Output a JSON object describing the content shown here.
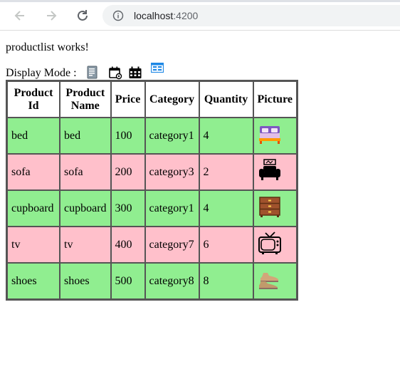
{
  "browser": {
    "url_host": "localhost",
    "url_port": ":4200"
  },
  "page": {
    "status_text": "productlist works!",
    "display_mode_label": "Display Mode :",
    "display_modes": [
      {
        "icon": "document-icon"
      },
      {
        "icon": "calendar-view-icon"
      },
      {
        "icon": "calendar-icon"
      },
      {
        "icon": "grid-table-icon"
      }
    ]
  },
  "table": {
    "headers": {
      "id_line1": "Product",
      "id_line2": "Id",
      "name_line1": "Product",
      "name_line2": "Name",
      "price": "Price",
      "category": "Category",
      "quantity": "Quantity",
      "picture": "Picture"
    },
    "rows": [
      {
        "id": "bed",
        "name": "bed",
        "price": "100",
        "category": "category1",
        "quantity": "4",
        "picture": "bed-icon",
        "bg": "#90ee90"
      },
      {
        "id": "sofa",
        "name": "sofa",
        "price": "200",
        "category": "category3",
        "quantity": "2",
        "picture": "sofa-icon",
        "bg": "#ffc0cb"
      },
      {
        "id": "cupboard",
        "name": "cupboard",
        "price": "300",
        "category": "category1",
        "quantity": "4",
        "picture": "cupboard-icon",
        "bg": "#90ee90"
      },
      {
        "id": "tv",
        "name": "tv",
        "price": "400",
        "category": "category7",
        "quantity": "6",
        "picture": "tv-icon",
        "bg": "#ffc0cb"
      },
      {
        "id": "shoes",
        "name": "shoes",
        "price": "500",
        "category": "category8",
        "quantity": "8",
        "picture": "shoes-icon",
        "bg": "#90ee90"
      }
    ]
  },
  "colors": {
    "row_green": "#90ee90",
    "row_pink": "#ffc0cb",
    "table_border": "#555555"
  }
}
